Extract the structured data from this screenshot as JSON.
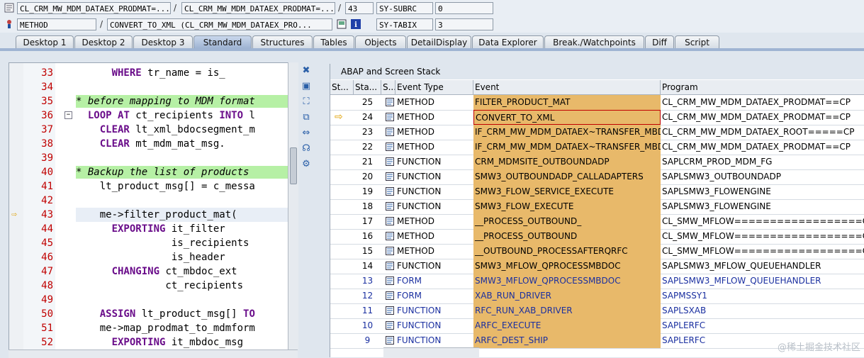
{
  "header": {
    "program_field": "CL_CRM_MW_MDM_DATAEX_PRODMAT=...",
    "include_field": "CL_CRM_MW_MDM_DATAEX_PRODMAT=...",
    "line_field": "43",
    "sy_subrc_label": "SY-SUBRC",
    "sy_subrc_value": "0",
    "event_type_field": "METHOD",
    "event_field": "CONVERT_TO_XML (CL_CRM_MW_MDM_DATAEX_PRO...",
    "sy_tabix_label": "SY-TABIX",
    "sy_tabix_value": "3",
    "sep": "/"
  },
  "tabs": [
    "Desktop 1",
    "Desktop 2",
    "Desktop 3",
    "Standard",
    "Structures",
    "Tables",
    "Objects",
    "DetailDisplay",
    "Data Explorer",
    "Break./Watchpoints",
    "Diff",
    "Script"
  ],
  "active_tab": "Standard",
  "editor": {
    "lines": [
      {
        "num": "33",
        "text": "      WHERE tr_name = is_"
      },
      {
        "num": "34",
        "text": ""
      },
      {
        "num": "35",
        "text": "* before mapping to MDM format"
      },
      {
        "num": "36",
        "text": "  LOOP AT ct_recipients INTO l"
      },
      {
        "num": "37",
        "text": "    CLEAR lt_xml_bdocsegment_m"
      },
      {
        "num": "38",
        "text": "    CLEAR mt_mdm_mat_msg."
      },
      {
        "num": "39",
        "text": ""
      },
      {
        "num": "40",
        "text": "* Backup the list of products"
      },
      {
        "num": "41",
        "text": "    lt_product_msg[] = c_messa"
      },
      {
        "num": "42",
        "text": ""
      },
      {
        "num": "43",
        "text": "    me->filter_product_mat("
      },
      {
        "num": "44",
        "text": "      EXPORTING it_filter"
      },
      {
        "num": "45",
        "text": "                is_recipients"
      },
      {
        "num": "46",
        "text": "                is_header"
      },
      {
        "num": "47",
        "text": "      CHANGING ct_mbdoc_ext"
      },
      {
        "num": "48",
        "text": "               ct_recipients"
      },
      {
        "num": "49",
        "text": ""
      },
      {
        "num": "50",
        "text": "    ASSIGN lt_product_msg[] TO"
      },
      {
        "num": "51",
        "text": "    me->map_prodmat_to_mdmform"
      },
      {
        "num": "52",
        "text": "      EXPORTING it_mbdoc_msg"
      }
    ]
  },
  "stack": {
    "title": "ABAP and Screen Stack",
    "columns": [
      "St...",
      "Sta...",
      "S...",
      "Event Type",
      "Event",
      "Program"
    ],
    "rows": [
      {
        "level": "25",
        "type": "METHOD",
        "event": "FILTER_PRODUCT_MAT",
        "program": "CL_CRM_MW_MDM_DATAEX_PRODMAT==CP",
        "blue": false,
        "current": false
      },
      {
        "level": "24",
        "type": "METHOD",
        "event": "CONVERT_TO_XML",
        "program": "CL_CRM_MW_MDM_DATAEX_PRODMAT==CP",
        "blue": false,
        "current": true
      },
      {
        "level": "23",
        "type": "METHOD",
        "event": "IF_CRM_MW_MDM_DATAEX~TRANSFER_MBD...",
        "program": "CL_CRM_MW_MDM_DATAEX_ROOT=====CP",
        "blue": false,
        "current": false
      },
      {
        "level": "22",
        "type": "METHOD",
        "event": "IF_CRM_MW_MDM_DATAEX~TRANSFER_MBD...",
        "program": "CL_CRM_MW_MDM_DATAEX_PRODMAT==CP",
        "blue": false,
        "current": false
      },
      {
        "level": "21",
        "type": "FUNCTION",
        "event": "CRM_MDMSITE_OUTBOUNDADP",
        "program": "SAPLCRM_PROD_MDM_FG",
        "blue": false,
        "current": false
      },
      {
        "level": "20",
        "type": "FUNCTION",
        "event": "SMW3_OUTBOUNDADP_CALLADAPTERS",
        "program": "SAPLSMW3_OUTBOUNDADP",
        "blue": false,
        "current": false
      },
      {
        "level": "19",
        "type": "FUNCTION",
        "event": "SMW3_FLOW_SERVICE_EXECUTE",
        "program": "SAPLSMW3_FLOWENGINE",
        "blue": false,
        "current": false
      },
      {
        "level": "18",
        "type": "FUNCTION",
        "event": "SMW3_FLOW_EXECUTE",
        "program": "SAPLSMW3_FLOWENGINE",
        "blue": false,
        "current": false
      },
      {
        "level": "17",
        "type": "METHOD",
        "event": "__PROCESS_OUTBOUND_",
        "program": "CL_SMW_MFLOW==================CP",
        "blue": false,
        "current": false
      },
      {
        "level": "16",
        "type": "METHOD",
        "event": "__PROCESS_OUTBOUND",
        "program": "CL_SMW_MFLOW==================CP",
        "blue": false,
        "current": false
      },
      {
        "level": "15",
        "type": "METHOD",
        "event": "__OUTBOUND_PROCESSAFTERQRFC",
        "program": "CL_SMW_MFLOW==================CP",
        "blue": false,
        "current": false
      },
      {
        "level": "14",
        "type": "FUNCTION",
        "event": "SMW3_MFLOW_QPROCESSMBDOC",
        "program": "SAPLSMW3_MFLOW_QUEUEHANDLER",
        "blue": false,
        "current": false
      },
      {
        "level": "13",
        "type": "FORM",
        "event": "SMW3_MFLOW_QPROCESSMBDOC",
        "program": "SAPLSMW3_MFLOW_QUEUEHANDLER",
        "blue": true,
        "current": false
      },
      {
        "level": "12",
        "type": "FORM",
        "event": "XAB_RUN_DRIVER",
        "program": "SAPMSSY1",
        "blue": true,
        "current": false
      },
      {
        "level": "11",
        "type": "FUNCTION",
        "event": "RFC_RUN_XAB_DRIVER",
        "program": "SAPLSXAB",
        "blue": true,
        "current": false
      },
      {
        "level": "10",
        "type": "FUNCTION",
        "event": "ARFC_EXECUTE",
        "program": "SAPLERFC",
        "blue": true,
        "current": false
      },
      {
        "level": "9",
        "type": "FUNCTION",
        "event": "ARFC_DEST_SHIP",
        "program": "SAPLERFC",
        "blue": true,
        "current": false
      }
    ]
  },
  "watermark": "@稀土掘金技术社区"
}
